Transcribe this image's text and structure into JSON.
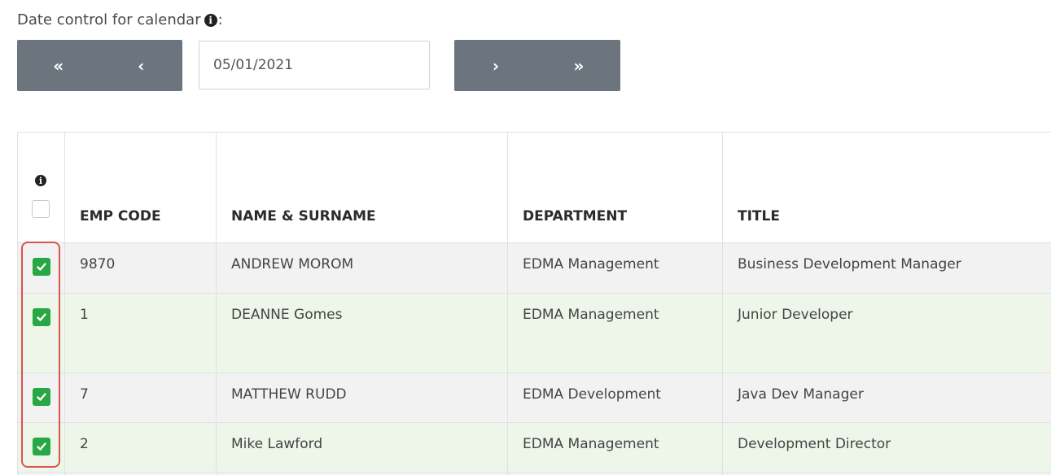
{
  "date_control": {
    "label": "Date control for calendar",
    "info_glyph": "i",
    "colon": ":",
    "date_value": "05/01/2021",
    "buttons": {
      "first": "«",
      "prev": "‹",
      "next": "›",
      "last": "»"
    },
    "button_color": "#6c757d"
  },
  "table": {
    "header_info_glyph": "i",
    "columns": [
      "EMP CODE",
      "NAME & SURNAME",
      "DEPARTMENT",
      "TITLE"
    ],
    "rows": [
      {
        "checked": true,
        "emp_code": "9870",
        "name": "ANDREW MOROM",
        "department": "EDMA Management",
        "title": "Business Development Manager"
      },
      {
        "checked": true,
        "emp_code": "1",
        "name": "DEANNE Gomes",
        "department": "EDMA Management",
        "title": "Junior Developer"
      },
      {
        "checked": true,
        "emp_code": "7",
        "name": "MATTHEW RUDD",
        "department": "EDMA Development",
        "title": "Java Dev Manager"
      },
      {
        "checked": true,
        "emp_code": "2",
        "name": "Mike Lawford",
        "department": "EDMA Management",
        "title": "Development Director"
      }
    ],
    "checkbox_color": "#28a745",
    "highlight_color": "#d9534f"
  }
}
